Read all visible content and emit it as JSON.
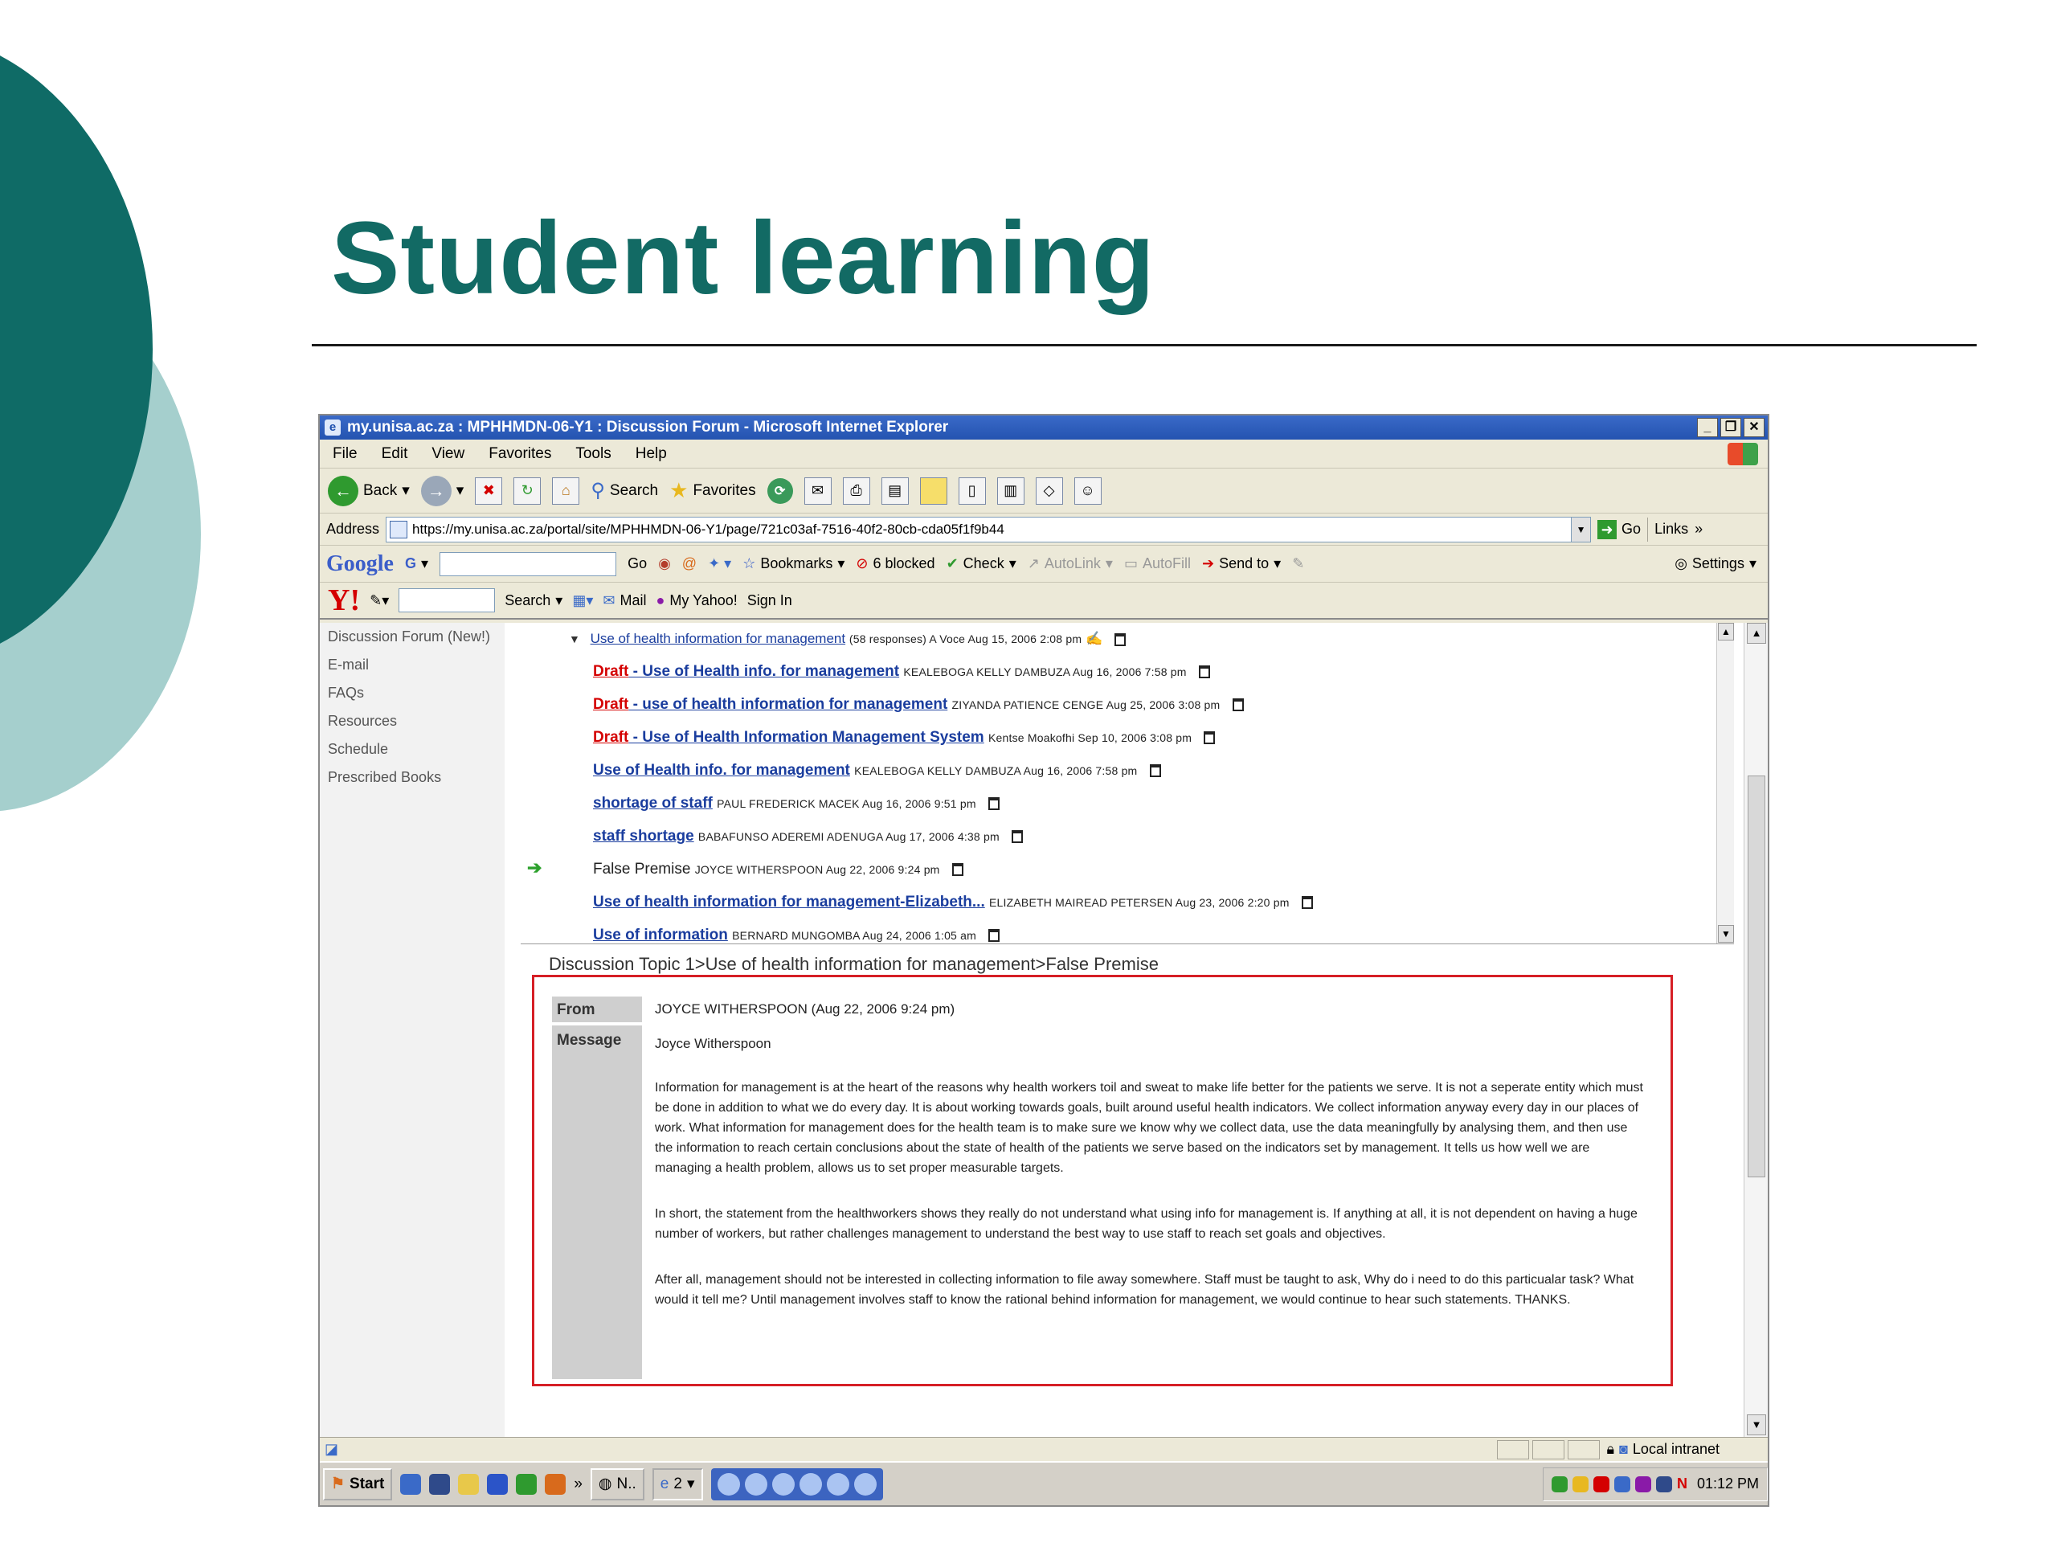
{
  "slide": {
    "title": "Student learning"
  },
  "browser": {
    "window_title": "my.unisa.ac.za : MPHHMDN-06-Y1 : Discussion Forum - Microsoft Internet Explorer",
    "menu": [
      "File",
      "Edit",
      "View",
      "Favorites",
      "Tools",
      "Help"
    ],
    "toolbar": {
      "back": "Back",
      "search": "Search",
      "favorites": "Favorites"
    },
    "address": {
      "label": "Address",
      "url": "https://my.unisa.ac.za/portal/site/MPHHMDN-06-Y1/page/721c03af-7516-40f2-80cb-cda05f1f9b44",
      "go": "Go",
      "links": "Links"
    },
    "google_bar": {
      "logo": "Google",
      "g_label": "G",
      "go": "Go",
      "bookmarks": "Bookmarks",
      "blocked": "6 blocked",
      "check": "Check",
      "autolink": "AutoLink",
      "autofill": "AutoFill",
      "send_to": "Send to",
      "settings": "Settings"
    },
    "yahoo_bar": {
      "logo": "Y!",
      "search": "Search",
      "mail": "Mail",
      "my_yahoo": "My Yahoo!",
      "sign_in": "Sign In"
    }
  },
  "left_nav": {
    "items": [
      "Discussion Forum (New!)",
      "E-mail",
      "FAQs",
      "Resources",
      "Schedule",
      "Prescribed Books"
    ]
  },
  "thread": {
    "root": {
      "title": "Use of health information for management",
      "meta": "(58 responses) A Voce Aug 15, 2006 2:08 pm"
    },
    "posts": [
      {
        "prefix": "Draft",
        "title": " - Use of Health info. for management",
        "meta": "KEALEBOGA KELLY DAMBUZA Aug 16, 2006 7:58 pm"
      },
      {
        "prefix": "Draft",
        "title": " - use of health information for management",
        "meta": "ZIYANDA PATIENCE CENGE Aug 25, 2006 3:08 pm"
      },
      {
        "prefix": "Draft",
        "title": " - Use of Health Information Management System",
        "meta": "Kentse Moakofhi Sep 10, 2006 3:08 pm"
      },
      {
        "prefix": "",
        "title": "Use of Health info. for management",
        "meta": "KEALEBOGA KELLY DAMBUZA Aug 16, 2006 7:58 pm"
      },
      {
        "prefix": "",
        "title": "shortage of staff",
        "meta": "PAUL FREDERICK MACEK Aug 16, 2006 9:51 pm"
      },
      {
        "prefix": "",
        "title": "staff shortage",
        "meta": "BABAFUNSO ADEREMI ADENUGA Aug 17, 2006 4:38 pm"
      },
      {
        "prefix": "",
        "title": "False Premise",
        "meta": "JOYCE WITHERSPOON Aug 22, 2006 9:24 pm"
      },
      {
        "prefix": "",
        "title": "Use of health information for management-Elizabeth...",
        "meta": "ELIZABETH MAIREAD PETERSEN Aug 23, 2006 2:20 pm"
      },
      {
        "prefix": "",
        "title": "Use of information",
        "meta": "BERNARD MUNGOMBA Aug 24, 2006 1:05 am"
      }
    ]
  },
  "breadcrumb": "Discussion Topic 1>Use of health information for management>False Premise",
  "message": {
    "from_label": "From",
    "message_label": "Message",
    "from_value": "JOYCE WITHERSPOON (Aug 22, 2006 9:24 pm)",
    "author": "Joyce Witherspoon",
    "paragraphs": [
      "Information for management is at the heart of the reasons why health workers toil and sweat to make life better for the patients we serve. It is not a seperate entity which must be done in addition to what we do every day. It is about working towards goals, built around useful health indicators. We collect information anyway every day in our places of work. What information for management does for the health team is to make sure we know why we collect data, use the data meaningfully by analysing them, and then use the information to reach certain conclusions about the state of health of the patients we serve based on the indicators set by management. It tells us how well we are managing a health problem, allows us to set proper measurable targets.",
      "In short, the statement from the healthworkers  shows they really do not understand what using info for management is. If anything at all, it is not dependent on having a huge number of workers, but rather challenges management to understand the best way to use staff to reach set goals and objectives.",
      "After all, management should not be interested in collecting information to file away somewhere. Staff must be taught to ask, Why do i need to do this particualar task? What would it tell me? Until management involves staff to know the rational behind information for management, we would continue to hear such statements. THANKS."
    ]
  },
  "status": {
    "zone": "Local intranet"
  },
  "taskbar": {
    "start": "Start",
    "item1": "N..",
    "item2": "2",
    "clock": "01:12 PM"
  },
  "colors": {
    "title_teal": "#126a64",
    "circle_dark": "#0f6b66",
    "circle_light": "#a5cfcd",
    "highlight_red": "#d61f26"
  }
}
